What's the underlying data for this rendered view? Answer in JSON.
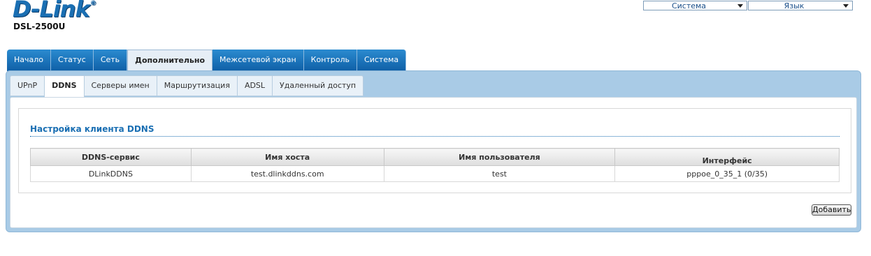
{
  "header": {
    "logo": "D-Link",
    "logo_mark": "®",
    "model": "DSL-2500U",
    "system_select": "Система",
    "language_select": "Язык"
  },
  "top_tabs": [
    {
      "label": "Начало"
    },
    {
      "label": "Статус"
    },
    {
      "label": "Сеть"
    },
    {
      "label": "Дополнительно",
      "active": true
    },
    {
      "label": "Межсетевой экран"
    },
    {
      "label": "Контроль"
    },
    {
      "label": "Система"
    }
  ],
  "sub_tabs": [
    {
      "label": "UPnP"
    },
    {
      "label": "DDNS",
      "active": true
    },
    {
      "label": "Серверы имен"
    },
    {
      "label": "Маршрутизация"
    },
    {
      "label": "ADSL"
    },
    {
      "label": "Удаленный доступ"
    }
  ],
  "section": {
    "title": "Настройка клиента DDNS"
  },
  "table": {
    "headers": [
      "DDNS-сервис",
      "Имя хоста",
      "Имя пользователя",
      "Интерфейс"
    ],
    "rows": [
      [
        "DLinkDDNS",
        "test.dlinkddns.com",
        "test",
        "pppoe_0_35_1 (0/35)"
      ]
    ]
  },
  "actions": {
    "add_label": "Добавить"
  },
  "colors": {
    "brand_blue": "#1a6fb3",
    "tab_blue": "#1670b8",
    "panel_bg": "#a9cbe6"
  }
}
